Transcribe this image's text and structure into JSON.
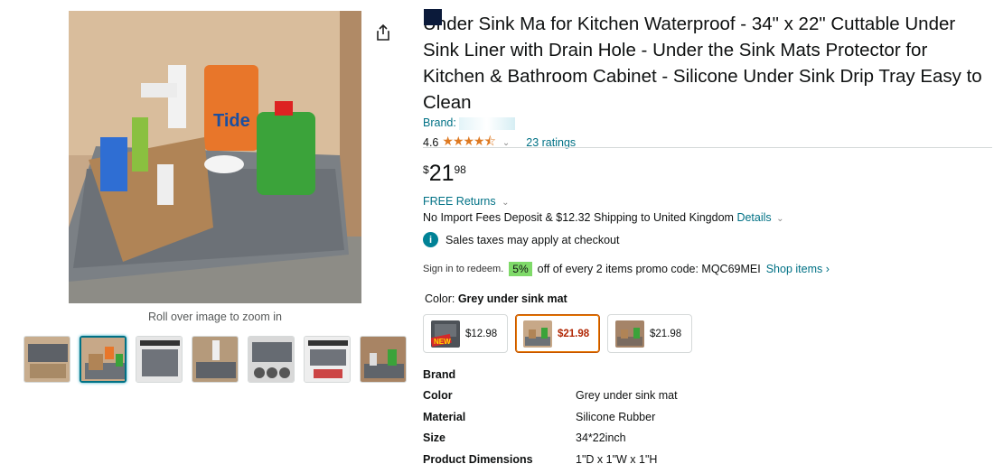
{
  "product": {
    "title": "Under Sink Ma  for Kitchen Waterproof - 34\" x 22\" Cuttable Under Sink Liner with Drain Hole - Under the Sink Mats Protector for Kitchen & Bathroom Cabinet - Silicone Under Sink Drip Tray Easy to Clean",
    "brand_label": "Brand:",
    "rating": "4.6",
    "stars": "★★★★⯪",
    "ratings_count": "23 ratings"
  },
  "gallery": {
    "zoom_hint": "Roll over image to zoom in",
    "thumbnail_count": 7,
    "selected_index": 1
  },
  "price": {
    "symbol": "$",
    "whole": "21",
    "fraction": "98"
  },
  "delivery": {
    "free_returns": "FREE Returns",
    "shipping_text": "No Import Fees Deposit & $12.32 Shipping to United Kingdom",
    "details_link": "Details",
    "tax_note": "Sales taxes may apply at checkout"
  },
  "promo": {
    "sign_in": "Sign in to redeem.",
    "percent": "5%",
    "text": "off of every 2 items promo code: MQC69MEI",
    "link": "Shop items ›"
  },
  "color": {
    "label": "Color:",
    "value": "Grey under sink mat",
    "options": [
      {
        "price": "$12.98",
        "badge": "NEW"
      },
      {
        "price": "$21.98"
      },
      {
        "price": "$21.98"
      }
    ]
  },
  "specs": [
    {
      "key": "Brand",
      "value": ""
    },
    {
      "key": "Color",
      "value": "Grey under sink mat"
    },
    {
      "key": "Material",
      "value": "Silicone Rubber"
    },
    {
      "key": "Size",
      "value": "34*22inch"
    },
    {
      "key": "Product Dimensions",
      "value": "1\"D x 1\"W x 1\"H"
    }
  ],
  "colors": {
    "link": "#007185",
    "price_red": "#b12704",
    "star": "#de7921",
    "promo_green": "#7fda69"
  }
}
